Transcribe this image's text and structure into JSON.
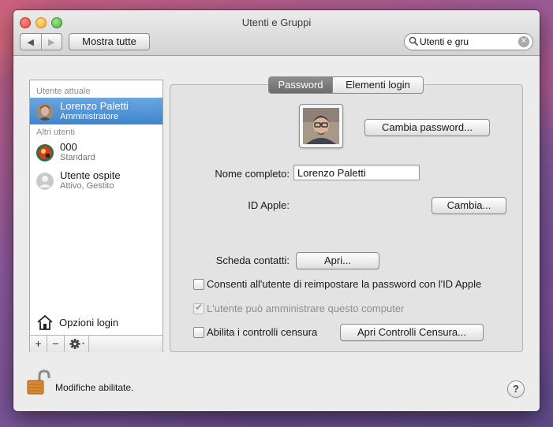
{
  "window": {
    "title": "Utenti e Gruppi"
  },
  "toolbar": {
    "back_label": "◀",
    "forward_label": "▶",
    "show_all_label": "Mostra tutte",
    "search_value": "Utenti e gru",
    "clear_label": "✕"
  },
  "sidebar": {
    "current_user_header": "Utente attuale",
    "current_user": {
      "name": "Lorenzo Paletti",
      "role": "Amministratore"
    },
    "other_users_header": "Altri utenti",
    "other_users": [
      {
        "name": "000",
        "role": "Standard"
      },
      {
        "name": "Utente ospite",
        "role": "Attivo, Gestito"
      }
    ],
    "login_options_label": "Opzioni login",
    "footer": {
      "add_label": "+",
      "remove_label": "−"
    }
  },
  "tabs": {
    "password": "Password",
    "login_items": "Elementi login",
    "active": "Password"
  },
  "form": {
    "change_password_button": "Cambia password...",
    "full_name_label": "Nome completo:",
    "full_name_value": "Lorenzo Paletti",
    "apple_id_label": "ID Apple:",
    "apple_id_button": "Cambia...",
    "contact_card_label": "Scheda contatti:",
    "contact_card_button": "Apri...",
    "reset_password_checkbox": {
      "label": "Consenti all'utente di reimpostare la password con l'ID Apple",
      "checked": false
    },
    "admin_checkbox": {
      "label": "L'utente può amministrare questo computer",
      "checked": true,
      "disabled": true
    },
    "parental_checkbox": {
      "label": "Abilita i controlli censura",
      "checked": false
    },
    "parental_button": "Apri Controlli Censura..."
  },
  "footer": {
    "lock_label": "Modifiche abilitate.",
    "help_label": "?"
  }
}
